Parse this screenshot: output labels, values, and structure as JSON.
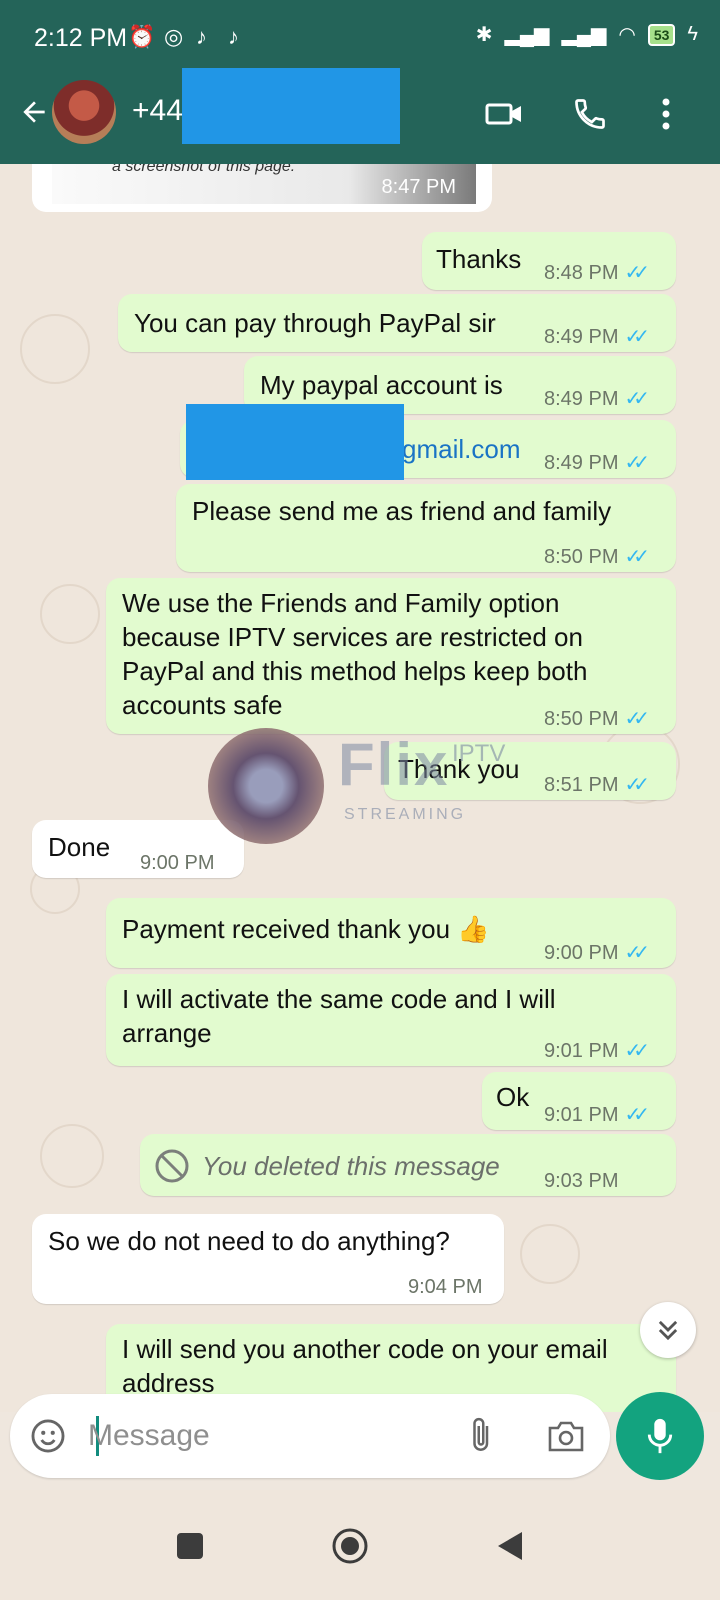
{
  "status_bar": {
    "time": "2:12 PM",
    "battery": "53",
    "icons": [
      "alarm-icon",
      "instagram-icon",
      "app-icon",
      "app-icon",
      "bluetooth-icon",
      "signal-icon",
      "signal-icon",
      "wifi-icon",
      "battery-icon",
      "charging-icon"
    ]
  },
  "header": {
    "contact": "+44",
    "icons": [
      "back-arrow-icon",
      "video-call-icon",
      "voice-call-icon",
      "more-vert-icon"
    ]
  },
  "messages": [
    {
      "dir": "out",
      "text": "a screenshot of this page.",
      "time": "8:47 PM",
      "type": "image"
    },
    {
      "dir": "out",
      "text": "Thanks",
      "time": "8:48 PM"
    },
    {
      "dir": "out",
      "text": "You can pay through PayPal sir",
      "time": "8:49 PM"
    },
    {
      "dir": "out",
      "text": "My paypal account is",
      "time": "8:49 PM"
    },
    {
      "dir": "out",
      "text": "gmail.com",
      "time": "8:49 PM"
    },
    {
      "dir": "out",
      "text": "Please send me as friend and family",
      "time": "8:50 PM"
    },
    {
      "dir": "out",
      "text": "We use the Friends and Family option because IPTV services are restricted on PayPal and this method helps keep both accounts safe",
      "time": "8:50 PM"
    },
    {
      "dir": "out",
      "text": "Thank you",
      "time": "8:51 PM"
    },
    {
      "dir": "in",
      "text": "Done",
      "time": "9:00 PM"
    },
    {
      "dir": "out",
      "text": "Payment received thank you 👍",
      "time": "9:00 PM"
    },
    {
      "dir": "out",
      "text": "I will activate the same code and I will arrange",
      "time": "9:01 PM"
    },
    {
      "dir": "out",
      "text": "Ok",
      "time": "9:01 PM"
    },
    {
      "dir": "out",
      "text": "You deleted this message",
      "time": "9:03 PM",
      "type": "deleted"
    },
    {
      "dir": "in",
      "text": "So we do not need to do anything?",
      "time": "9:04 PM"
    },
    {
      "dir": "out",
      "text": "I will send you another code on your email address",
      "time": ""
    }
  ],
  "watermark": {
    "brand": "Flix",
    "suffix": "IPTV",
    "sub": "STREAMING"
  },
  "composer": {
    "placeholder": "Message"
  },
  "colors": {
    "header": "#246459",
    "outgoing": "#e2fbcf",
    "incoming": "#ffffff",
    "mic": "#13a37f",
    "ticks": "#34b7f1"
  }
}
